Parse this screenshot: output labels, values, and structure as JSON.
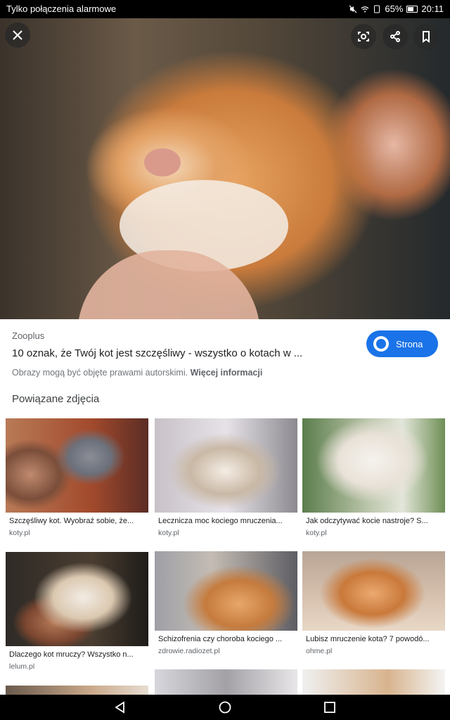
{
  "status_bar": {
    "carrier_text": "Tylko połączenia alarmowe",
    "battery": "65%",
    "time": "20:11"
  },
  "viewer": {
    "close_icon": "close-icon",
    "lens_icon": "google-lens-icon",
    "share_icon": "share-icon",
    "bookmark_icon": "bookmark-icon"
  },
  "result": {
    "source": "Zooplus",
    "title": "10 oznak, że Twój kot jest szczęśliwy - wszystko o kotach w ...",
    "copyright_text": "Obrazy mogą być objęte prawami autorskimi.",
    "more_info": "Więcej informacji",
    "visit_label": "Strona"
  },
  "related": {
    "heading": "Powiązane zdjęcia",
    "items": [
      {
        "caption": "Szczęśliwy kot. Wyobraź sobie, że...",
        "domain": "koty.pl"
      },
      {
        "caption": "Lecznicza moc kociego mruczenia...",
        "domain": "koty.pl"
      },
      {
        "caption": "Jak odczytywać kocie nastroje? S...",
        "domain": "koty.pl"
      },
      {
        "caption": "Dlaczego kot mruczy? Wszystko n...",
        "domain": "lelum.pl"
      },
      {
        "caption": "Schizofrenia czy choroba kociego ...",
        "domain": "zdrowie.radiozet.pl"
      },
      {
        "caption": "Lubisz mruczenie kota? 7 powodó...",
        "domain": "ohme.pl"
      }
    ]
  },
  "colors": {
    "accent": "#1a73e8"
  }
}
